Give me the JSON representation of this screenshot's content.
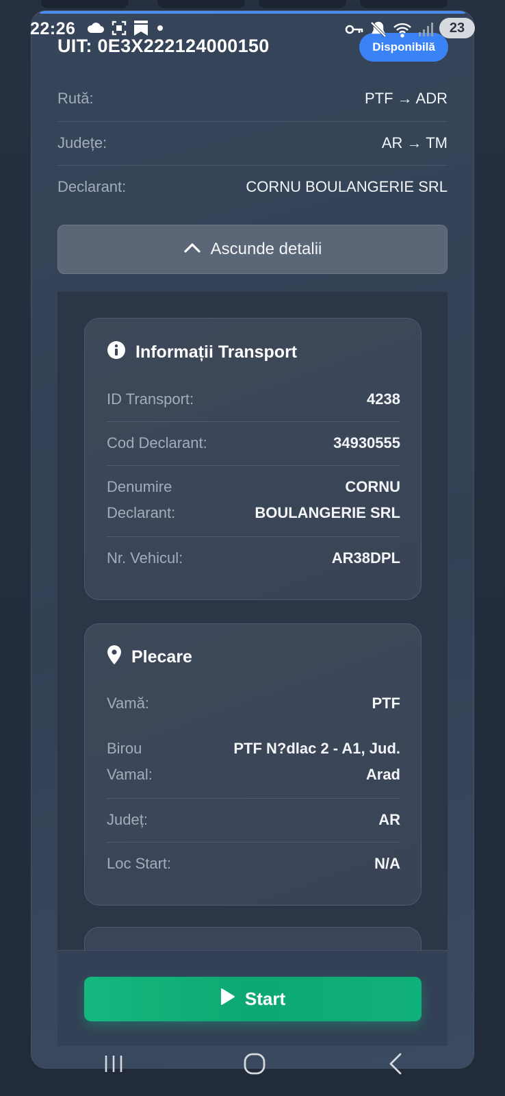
{
  "status_bar": {
    "time": "22:26",
    "battery": "23",
    "left_icons": [
      "cloud-icon",
      "screenshot-icon",
      "bookmark-icon",
      "dot-icon"
    ],
    "right_icons": [
      "key-icon",
      "mute-icon",
      "wifi-icon",
      "signal-icon"
    ]
  },
  "header": {
    "uit": "UIT: 0E3X222124000150",
    "status": "Disponibilă"
  },
  "summary": {
    "route_label": "Rută:",
    "route_value": "PTF → ADR",
    "counties_label": "Județe:",
    "counties_value": "AR → TM",
    "declarant_label": "Declarant:",
    "declarant_value": "CORNU BOULANGERIE SRL"
  },
  "toggle": {
    "label": "Ascunde detalii"
  },
  "transport": {
    "title": "Informații Transport",
    "id_label": "ID Transport:",
    "id_value": "4238",
    "cod_label": "Cod Declarant:",
    "cod_value": "34930555",
    "name_label_1": "Denumire",
    "name_label_2": "Declarant:",
    "name_value_1": "CORNU",
    "name_value_2": "BOULANGERIE SRL",
    "vehicle_label": "Nr. Vehicul:",
    "vehicle_value": "AR38DPL"
  },
  "departure": {
    "title": "Plecare",
    "customs_label": "Vamă:",
    "customs_value": "PTF",
    "office_label_1": "Birou",
    "office_label_2": "Vamal:",
    "office_value_1": "PTF N?dlac 2 - A1, Jud.",
    "office_value_2": "Arad",
    "county_label": "Județ:",
    "county_value": "AR",
    "start_label": "Loc Start:",
    "start_value": "N/A"
  },
  "actions": {
    "start_label": "Start"
  },
  "colors": {
    "accent_blue": "#3b82f6",
    "start_green": "#10b981",
    "card_bg": "#334155"
  }
}
